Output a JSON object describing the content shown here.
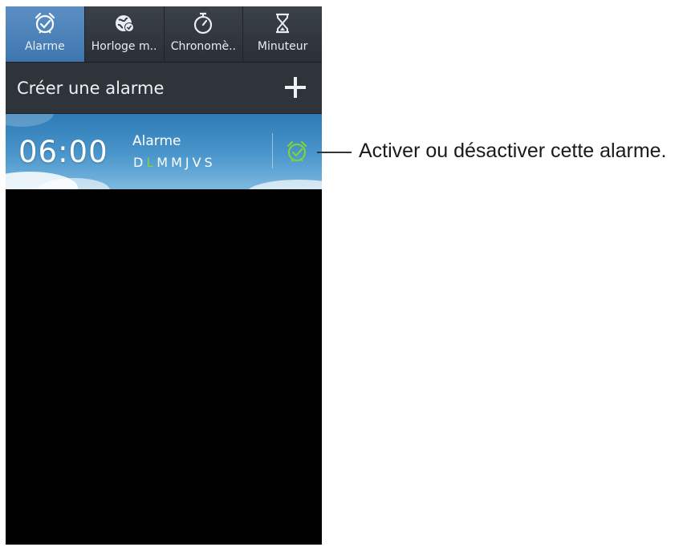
{
  "tabs": [
    {
      "label": "Alarme",
      "icon": "alarm-clock-icon",
      "active": true
    },
    {
      "label": "Horloge m..",
      "icon": "world-clock-icon",
      "active": false
    },
    {
      "label": "Chronomè..",
      "icon": "stopwatch-icon",
      "active": false
    },
    {
      "label": "Minuteur",
      "icon": "hourglass-icon",
      "active": false
    }
  ],
  "create_alarm": {
    "label": "Créer une alarme",
    "icon": "plus-icon"
  },
  "alarm": {
    "time": "06:00",
    "name": "Alarme",
    "days": [
      "D",
      "L",
      "M",
      "M",
      "J",
      "V",
      "S"
    ],
    "active_days": [
      false,
      true,
      false,
      false,
      false,
      false,
      false
    ],
    "toggle_icon": "alarm-toggle-icon",
    "toggle_color": "#7ed23a"
  },
  "callout": {
    "text": "Activer ou désactiver cette alarme."
  },
  "colors": {
    "active_tab": "#4a82ba",
    "tab_bar": "#353a41",
    "create_bar": "#2f343b",
    "active_day": "#7ed23a"
  }
}
